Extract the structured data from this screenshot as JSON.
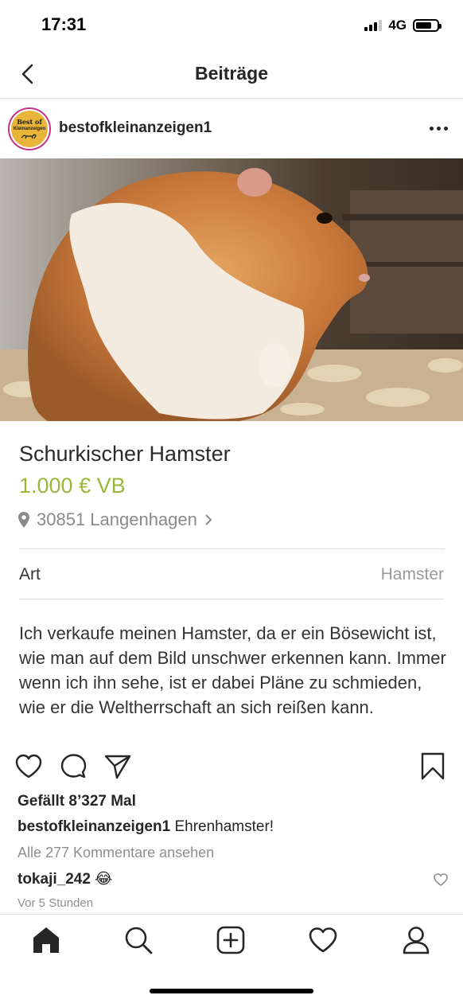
{
  "status_bar": {
    "time": "17:31",
    "network": "4G"
  },
  "nav": {
    "title": "Beiträge",
    "back_icon": "chevron-left-icon"
  },
  "post": {
    "username": "bestofkleinanzeigen1",
    "avatar": {
      "line1": "Best of",
      "line2": "Kleinanzeigen"
    },
    "more_icon": "more-horizontal-icon"
  },
  "listing": {
    "title": "Schurkischer Hamster",
    "price": "1.000 € VB",
    "location": "30851 Langenhagen",
    "attribute_label": "Art",
    "attribute_value": "Hamster",
    "description": "Ich verkaufe meinen Hamster, da er ein Bösewicht ist, wie man auf dem Bild unschwer erkennen kann. Immer wenn ich ihn sehe, ist er dabei Pläne zu schmieden, wie er die Weltherrschaft an sich reißen kann.",
    "price_color": "#9bb83a"
  },
  "actions": {
    "icons": [
      "heart-icon",
      "comment-icon",
      "share-icon",
      "bookmark-icon"
    ]
  },
  "engagement": {
    "likes": "Gefällt 8’327 Mal",
    "caption_user": "bestofkleinanzeigen1",
    "caption_text": " Ehrenhamster!",
    "view_comments": "Alle 277 Kommentare ansehen",
    "comment_user": "tokaji_242",
    "comment_text": " 😂",
    "timestamp": "Vor 5 Stunden"
  },
  "tabbar": {
    "icons": [
      "home-icon",
      "search-icon",
      "add-post-icon",
      "activity-heart-icon",
      "profile-icon"
    ]
  },
  "colors": {
    "text": "#262626",
    "muted": "#8e8e8e",
    "divider": "#dbdbdb",
    "avatar_ring": "#c13584"
  }
}
